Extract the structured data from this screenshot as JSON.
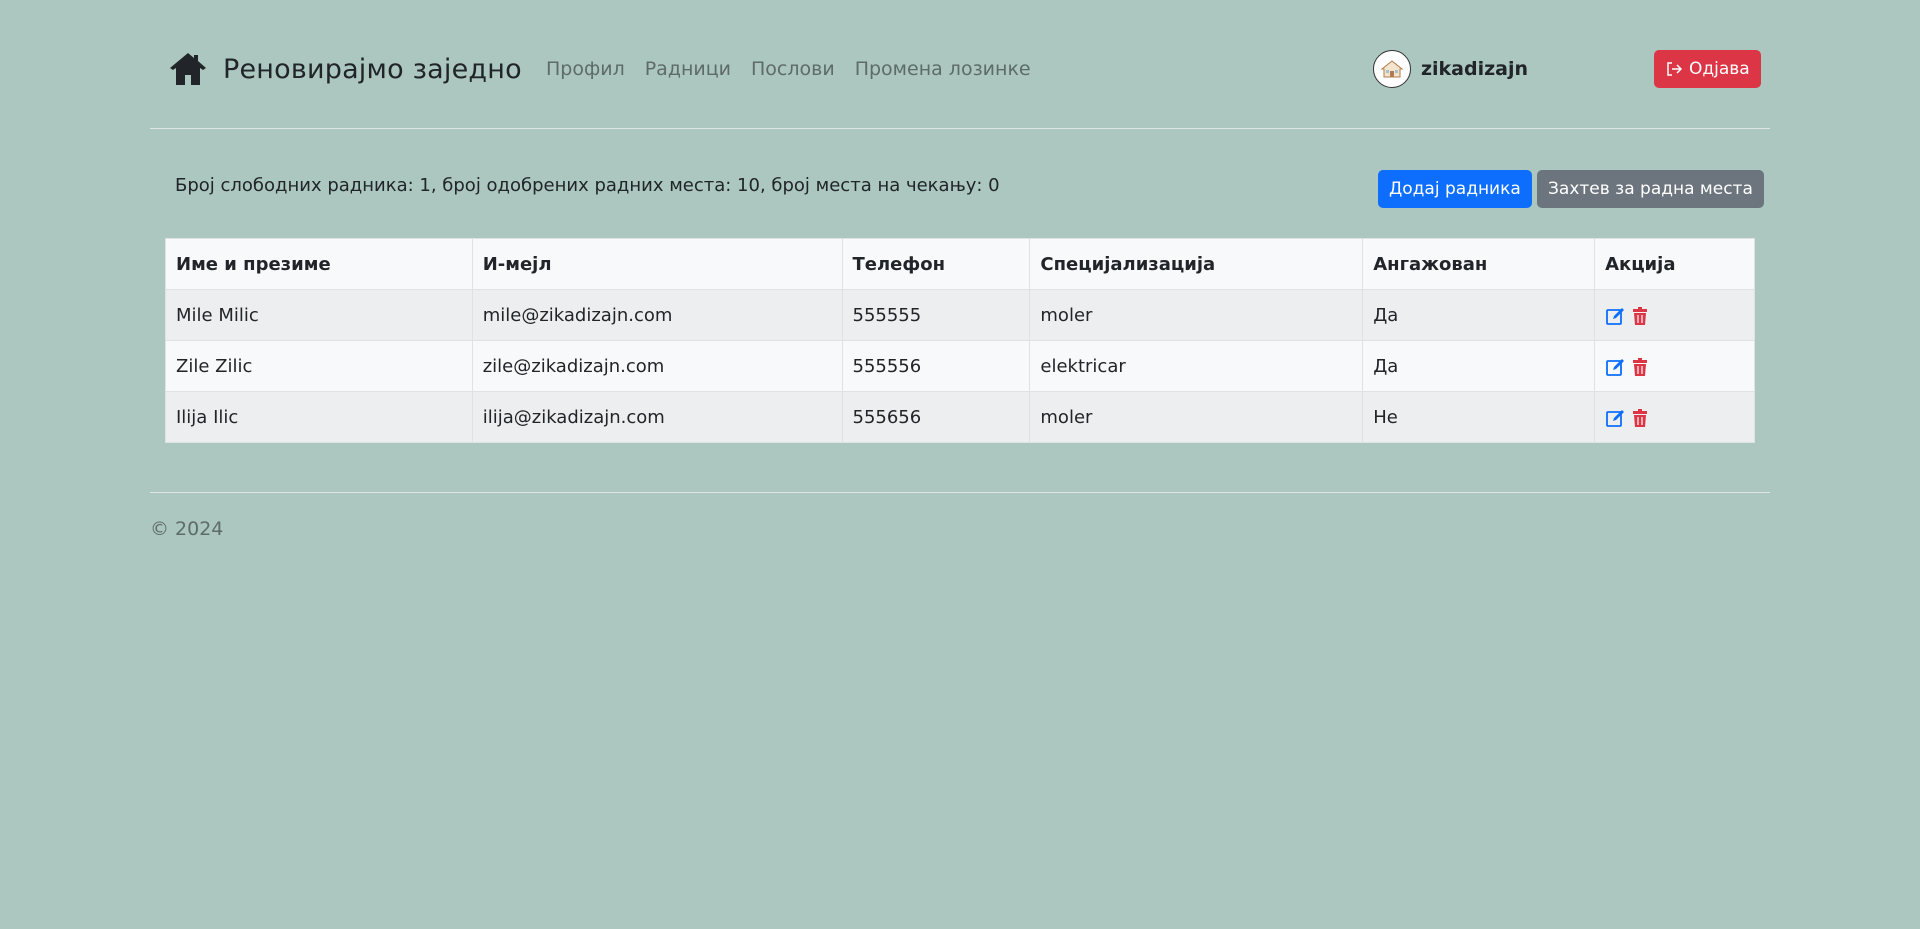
{
  "header": {
    "brand": "Реновирајмо заједно",
    "nav": [
      "Профил",
      "Радници",
      "Послови",
      "Промена лозинке"
    ],
    "username": "zikadizajn",
    "logout_label": "Одјава"
  },
  "summary": {
    "text": "Број слободних радника: 1, број одобрених радних места: 10, број места на чекању: 0",
    "add_worker_label": "Додај радника",
    "request_label": "Захтев за радна места"
  },
  "table": {
    "headers": [
      "Име и презиме",
      "И-мејл",
      "Телефон",
      "Специјализација",
      "Ангажован",
      "Акција"
    ],
    "rows": [
      {
        "name": "Mile Milic",
        "email": "mile@zikadizajn.com",
        "phone": "555555",
        "spec": "moler",
        "engaged": "Да"
      },
      {
        "name": "Zile Zilic",
        "email": "zile@zikadizajn.com",
        "phone": "555556",
        "spec": "elektricar",
        "engaged": "Да"
      },
      {
        "name": "Ilija Ilic",
        "email": "ilija@zikadizajn.com",
        "phone": "555656",
        "spec": "moler",
        "engaged": "Не"
      }
    ]
  },
  "footer": {
    "copyright": "© 2024"
  },
  "icons": {
    "brand": "house-icon",
    "edit": "edit-icon",
    "delete": "trash-icon",
    "logout": "logout-icon",
    "avatar": "house-avatar"
  },
  "colors": {
    "background": "#abc7bf",
    "primary": "#0d6efd",
    "danger": "#dc3545",
    "secondary": "#6c757d"
  }
}
